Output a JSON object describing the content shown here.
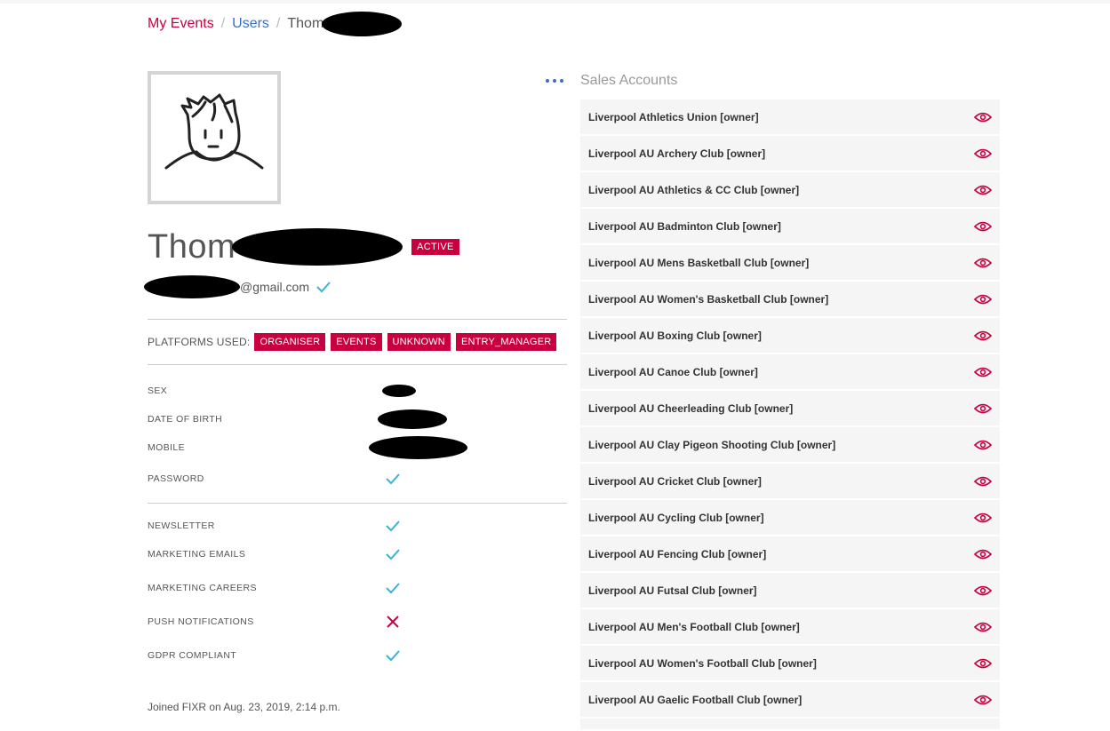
{
  "colors": {
    "brand": "#c8003f",
    "link": "#3a6fc7",
    "check": "#3bb4cf",
    "cross": "#c8003f"
  },
  "breadcrumb": {
    "my_events": "My Events",
    "users": "Users",
    "current": "Thom"
  },
  "user": {
    "first_name": "Thom",
    "status": "ACTIVE",
    "email_domain": "@gmail.com",
    "email_verified_icon": "check-icon",
    "avatar_icon": "avatar-icon"
  },
  "more_icon": "more-dots-icon",
  "platforms": {
    "label": "PLATFORMS USED:",
    "items": [
      "ORGANISER",
      "EVENTS",
      "UNKNOWN",
      "ENTRY_MANAGER"
    ]
  },
  "details": [
    {
      "label": "SEX",
      "value": "redacted"
    },
    {
      "label": "DATE OF BIRTH",
      "value": "redacted"
    },
    {
      "label": "MOBILE",
      "value": "redacted"
    },
    {
      "label": "PASSWORD",
      "value": "check"
    }
  ],
  "preferences": [
    {
      "label": "NEWSLETTER",
      "value": "check"
    },
    {
      "label": "MARKETING EMAILS",
      "value": "check"
    },
    {
      "label": "MARKETING CAREERS",
      "value": "check"
    },
    {
      "label": "PUSH NOTIFICATIONS",
      "value": "cross"
    },
    {
      "label": "GDPR COMPLIANT",
      "value": "check"
    }
  ],
  "joined": "Joined FIXR on Aug. 23, 2019, 2:14 p.m.",
  "sales_accounts": {
    "title": "Sales Accounts",
    "view_icon": "eye-icon",
    "items": [
      "Liverpool Athletics Union [owner]",
      "Liverpool AU Archery Club [owner]",
      "Liverpool AU Athletics & CC Club [owner]",
      "Liverpool AU Badminton Club [owner]",
      "Liverpool AU Mens Basketball Club [owner]",
      "Liverpool AU Women's Basketball Club [owner]",
      "Liverpool AU Boxing Club [owner]",
      "Liverpool AU Canoe Club [owner]",
      "Liverpool AU Cheerleading Club [owner]",
      "Liverpool AU Clay Pigeon Shooting Club [owner]",
      "Liverpool AU Cricket Club [owner]",
      "Liverpool AU Cycling Club [owner]",
      "Liverpool AU Fencing Club [owner]",
      "Liverpool AU Futsal Club [owner]",
      "Liverpool AU Men's Football Club [owner]",
      "Liverpool AU Women's Football Club [owner]",
      "Liverpool AU Gaelic Football Club [owner]"
    ]
  }
}
